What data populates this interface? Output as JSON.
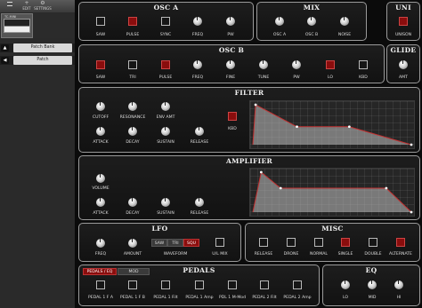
{
  "sidebar": {
    "toolbar": {
      "left_label": "",
      "mid_label": "EDIT",
      "right_label": "SETTINGS"
    },
    "preview_caption": "TC-MINI",
    "rows": [
      {
        "label": "Patch Bank",
        "icon": "arrow-up-icon"
      },
      {
        "label": "Patch",
        "icon": "arrow-left-icon"
      }
    ]
  },
  "osc_a": {
    "title": "OSC A",
    "controls": [
      {
        "label": "SAW",
        "kind": "switch",
        "on": false
      },
      {
        "label": "PULSE",
        "kind": "switch",
        "on": true
      },
      {
        "label": "SYNC",
        "kind": "switch",
        "on": false
      },
      {
        "label": "FREQ",
        "kind": "knob"
      },
      {
        "label": "PW",
        "kind": "knob"
      }
    ]
  },
  "mix": {
    "title": "MIX",
    "controls": [
      {
        "label": "OSC A",
        "kind": "knob"
      },
      {
        "label": "OSC B",
        "kind": "knob"
      },
      {
        "label": "NOISE",
        "kind": "knob"
      }
    ]
  },
  "uni": {
    "title": "UNI",
    "controls": [
      {
        "label": "UNISON",
        "kind": "switch",
        "on": true
      }
    ]
  },
  "osc_b": {
    "title": "OSC B",
    "controls": [
      {
        "label": "SAW",
        "kind": "switch",
        "on": true
      },
      {
        "label": "TRI",
        "kind": "switch",
        "on": false
      },
      {
        "label": "PULSE",
        "kind": "switch",
        "on": true
      },
      {
        "label": "FREQ",
        "kind": "knob"
      },
      {
        "label": "FINE",
        "kind": "knob"
      },
      {
        "label": "TUNE",
        "kind": "knob"
      },
      {
        "label": "PW",
        "kind": "knob"
      },
      {
        "label": "LO",
        "kind": "switch",
        "on": true
      },
      {
        "label": "KBD",
        "kind": "switch",
        "on": false
      }
    ]
  },
  "glide": {
    "title": "GLIDE",
    "controls": [
      {
        "label": "AMT",
        "kind": "knob"
      }
    ]
  },
  "filter": {
    "title": "FILTER",
    "row1": [
      {
        "label": "CUTOFF",
        "kind": "knob"
      },
      {
        "label": "RESONANCE",
        "kind": "knob"
      },
      {
        "label": "ENV AMT",
        "kind": "knob"
      }
    ],
    "row2": [
      {
        "label": "ATTACK",
        "kind": "knob"
      },
      {
        "label": "DECAY",
        "kind": "knob"
      },
      {
        "label": "SUSTAIN",
        "kind": "knob"
      },
      {
        "label": "RELEASE",
        "kind": "knob"
      }
    ],
    "kbd": {
      "label": "KBD",
      "on": true
    },
    "envelope": {
      "attack": 0.02,
      "decay": 0.3,
      "sustain": 0.45,
      "release": 0.45
    }
  },
  "amplifier": {
    "title": "AMPLIFIER",
    "volume": {
      "label": "VOLUME"
    },
    "row2": [
      {
        "label": "ATTACK",
        "kind": "knob"
      },
      {
        "label": "DECAY",
        "kind": "knob"
      },
      {
        "label": "SUSTAIN",
        "kind": "knob"
      },
      {
        "label": "RELEASE",
        "kind": "knob"
      }
    ],
    "envelope": {
      "attack": 0.03,
      "decay": 0.07,
      "sustain": 0.6,
      "release": 0.09
    }
  },
  "lfo": {
    "title": "LFO",
    "knobs": [
      {
        "label": "FREQ"
      },
      {
        "label": "AMOUNT"
      }
    ],
    "waveform": {
      "label": "WAVEFORM",
      "options": [
        "SAW",
        "TRI",
        "SQU"
      ],
      "selected": "SQU"
    },
    "uil_mix": {
      "label": "U/L MIX",
      "on": false
    }
  },
  "misc": {
    "title": "MISC",
    "controls": [
      {
        "label": "RELEASE",
        "on": false
      },
      {
        "label": "DRONE",
        "on": false
      },
      {
        "label": "NORMAL",
        "on": false
      },
      {
        "label": "SINGLE",
        "on": true
      },
      {
        "label": "DOUBLE",
        "on": false
      },
      {
        "label": "ALTERNATE",
        "on": true
      }
    ]
  },
  "pedals": {
    "title": "PEDALS",
    "tabs": [
      {
        "label": "PEDALS / EQ",
        "on": true
      },
      {
        "label": "MOD",
        "on": false
      }
    ],
    "controls": [
      {
        "label": "PEDAL 1 F A"
      },
      {
        "label": "PEDAL 1 F B"
      },
      {
        "label": "PEDAL 1 Filt"
      },
      {
        "label": "PEDAL 1 Amp"
      },
      {
        "label": "PDL 1 M-Mod"
      },
      {
        "label": "PEDAL 2 Filt"
      },
      {
        "label": "PEDAL 2 Amp"
      }
    ]
  },
  "eq": {
    "title": "EQ",
    "controls": [
      {
        "label": "LO"
      },
      {
        "label": "MID"
      },
      {
        "label": "HI"
      }
    ]
  }
}
